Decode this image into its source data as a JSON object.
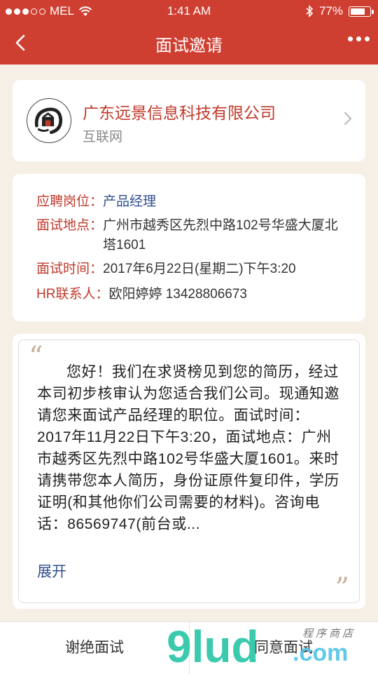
{
  "status": {
    "carrier": "MEL",
    "time": "1:41 AM",
    "battery": "77%",
    "battery_level": 0.77
  },
  "nav": {
    "title": "面试邀请"
  },
  "company": {
    "name": "广东远景信息科技有限公司",
    "industry": "互联网"
  },
  "details": {
    "position_label": "应聘岗位：",
    "position_value": "产品经理",
    "address_label": "面试地点：",
    "address_value": "广州市越秀区先烈中路102号华盛大厦北塔1601",
    "time_label": "面试时间：",
    "time_value": "2017年6月22日(星期二)下午3:20",
    "hr_label": "HR联系人：",
    "hr_value": "欧阳婷婷 13428806673"
  },
  "message": {
    "quote_open": "“",
    "quote_close": "”",
    "text": "您好！我们在求贤榜见到您的简历，经过本司初步核审认为您适合我们公司。现通知邀请您来面试产品经理的职位。面试时间：2017年11月22日下午3:20，面试地点：广州市越秀区先烈中路102号华盛大厦1601。来时请携带您本人简历，身份证原件复印件，学历证明(和其他你们公司需要的材料)。咨询电话：86569747(前台或...",
    "expand_label": "展开"
  },
  "actions": {
    "decline": "谢绝面试",
    "accept": "同意面试"
  },
  "watermark": {
    "brand": "9lud",
    "domain": ".com",
    "tagline": "程序商店"
  },
  "colors": {
    "primary": "#cf3f31",
    "accent_red": "#c0392b",
    "link_blue": "#2f4f8f",
    "background": "#f6efe6"
  }
}
